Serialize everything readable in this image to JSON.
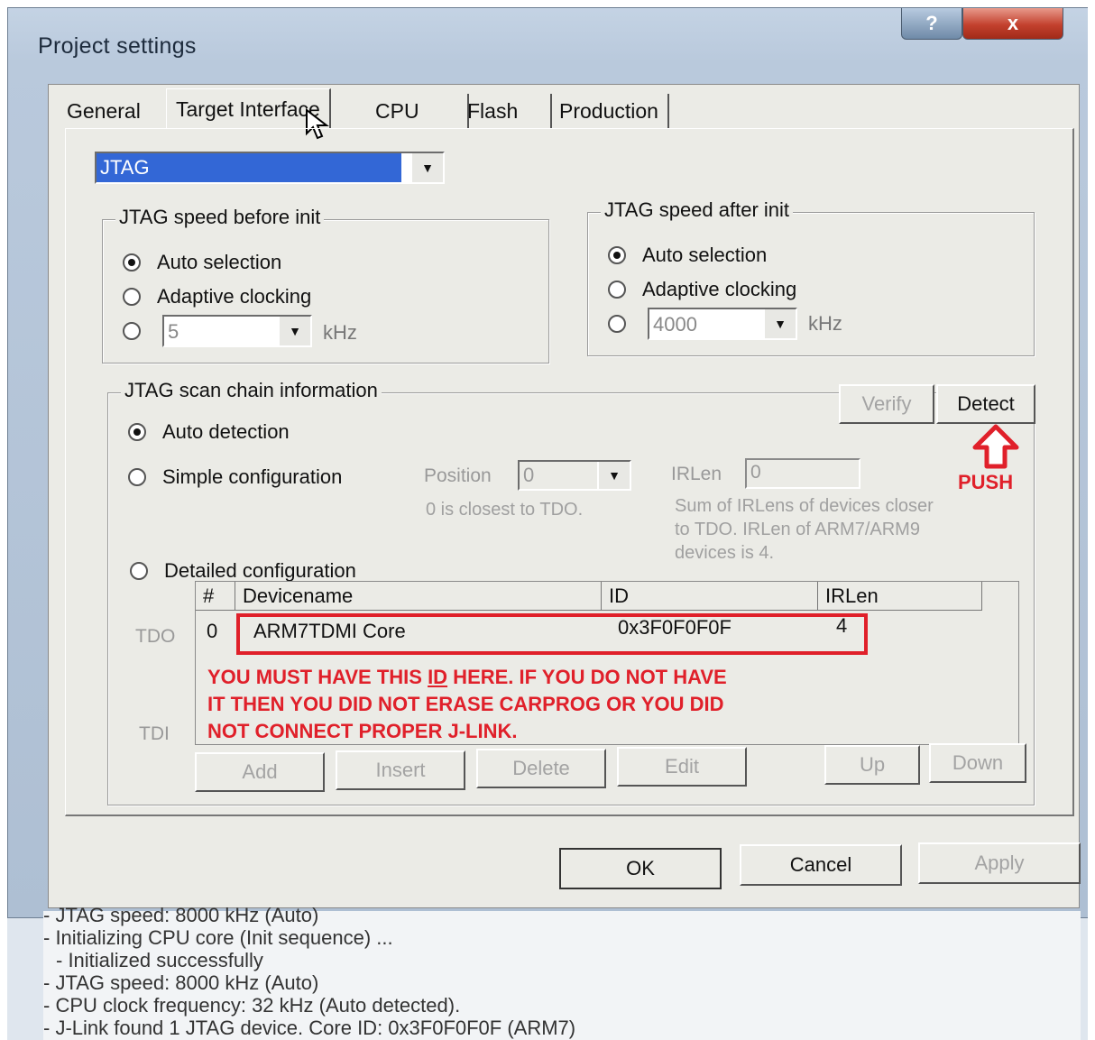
{
  "window": {
    "title": "Project settings",
    "help_label": "?",
    "close_label": "x"
  },
  "tabs": [
    {
      "label": "General"
    },
    {
      "label": "Target Interface"
    },
    {
      "label": "CPU"
    },
    {
      "label": "Flash"
    },
    {
      "label": "Production"
    }
  ],
  "interface_select": {
    "value": "JTAG"
  },
  "speed_before": {
    "legend": "JTAG speed before init",
    "auto": "Auto selection",
    "adaptive": "Adaptive clocking",
    "khz_value": "5",
    "unit": "kHz"
  },
  "speed_after": {
    "legend": "JTAG speed after init",
    "auto": "Auto selection",
    "adaptive": "Adaptive clocking",
    "khz_value": "4000",
    "unit": "kHz"
  },
  "scan_chain": {
    "legend": "JTAG scan chain information",
    "verify_label": "Verify",
    "detect_label": "Detect",
    "push_label": "PUSH",
    "auto_detection": "Auto detection",
    "simple_config": "Simple configuration",
    "position_label": "Position",
    "position_value": "0",
    "position_hint": "0 is closest to TDO.",
    "irlen_label": "IRLen",
    "irlen_value": "0",
    "irlen_hint_1": "Sum of IRLens of devices closer",
    "irlen_hint_2": "to TDO. IRLen of ARM7/ARM9",
    "irlen_hint_3": "devices is 4.",
    "detailed_config": "Detailed configuration",
    "tdo_label": "TDO",
    "tdi_label": "TDI",
    "table": {
      "headers": [
        "#",
        "Devicename",
        "ID",
        "IRLen"
      ],
      "rows": [
        {
          "num": "0",
          "name": "ARM7TDMI Core",
          "id": "0x3F0F0F0F",
          "irlen": "4"
        }
      ]
    },
    "note_1a": "YOU MUST HAVE THIS ",
    "note_1b": "ID",
    "note_1c": " HERE. IF YOU DO NOT HAVE",
    "note_2": "IT THEN YOU DID NOT ERASE CARPROG OR YOU DID",
    "note_3": "NOT CONNECT PROPER J-LINK.",
    "buttons": {
      "add": "Add",
      "insert": "Insert",
      "delete": "Delete",
      "edit": "Edit",
      "up": "Up",
      "down": "Down"
    }
  },
  "footer": {
    "ok": "OK",
    "cancel": "Cancel",
    "apply": "Apply"
  },
  "log": [
    "- JTAG speed: 8000 kHz (Auto)",
    "- Initializing CPU core (Init sequence) ...",
    "  - Initialized successfully",
    "- JTAG speed: 8000 kHz (Auto)",
    "- CPU clock frequency: 32 kHz (Auto detected).",
    "- J-Link found 1 JTAG device. Core ID: 0x3F0F0F0F (ARM7)"
  ],
  "colors": {
    "annotation_red": "#e0202a",
    "selection_blue": "#3367d6"
  }
}
